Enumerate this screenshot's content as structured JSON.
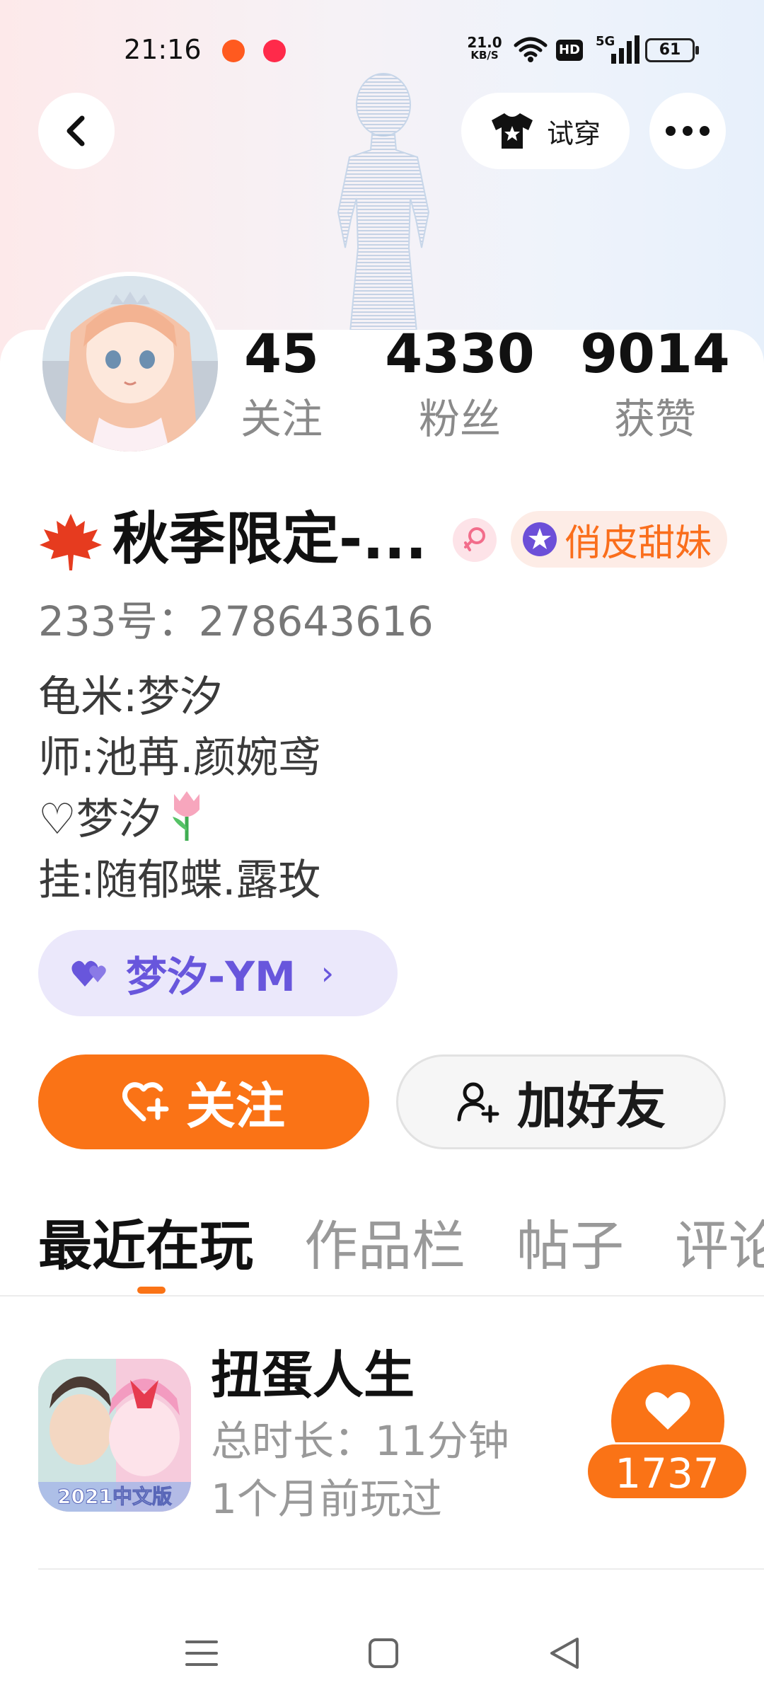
{
  "status_bar": {
    "time": "21:16",
    "net_speed_value": "21.0",
    "net_speed_unit": "KB/S",
    "hd_label": "HD",
    "signal_label": "5G",
    "battery": "61"
  },
  "header": {
    "tryon_label": "试穿"
  },
  "stats": [
    {
      "value": "45",
      "label": "关注"
    },
    {
      "value": "4330",
      "label": "粉丝"
    },
    {
      "value": "9014",
      "label": "获赞"
    }
  ],
  "profile": {
    "name": "秋季限定-...",
    "title_badge": "俏皮甜妹",
    "uid": "233号：278643616",
    "bio": [
      "龟米:梦汐",
      "师:池苒.颜婉鸢",
      "♡梦汐",
      "挂:随郁蝶.露玫"
    ]
  },
  "cp_tag": {
    "label": "梦汐-YM",
    "chevron": "›"
  },
  "actions": {
    "follow_label": "关注",
    "add_friend_label": "加好友"
  },
  "tabs": [
    "最近在玩",
    "作品栏",
    "帖子",
    "评论"
  ],
  "recent_games": [
    {
      "name": "扭蛋人生",
      "duration": "总时长：11分钟",
      "last_played": "1个月前玩过",
      "likes": "1737",
      "icon_text": "2021中文版"
    }
  ],
  "colors": {
    "accent": "#fa7316",
    "cp_purple": "#6856dc",
    "title_badge_text": "#fa6e1c"
  },
  "icons": {
    "back": "chevron-left-icon",
    "tryon": "tshirt-icon",
    "more": "more-dots-icon",
    "follow": "heart-plus-icon",
    "add_friend": "user-plus-icon",
    "like": "heart-icon"
  }
}
